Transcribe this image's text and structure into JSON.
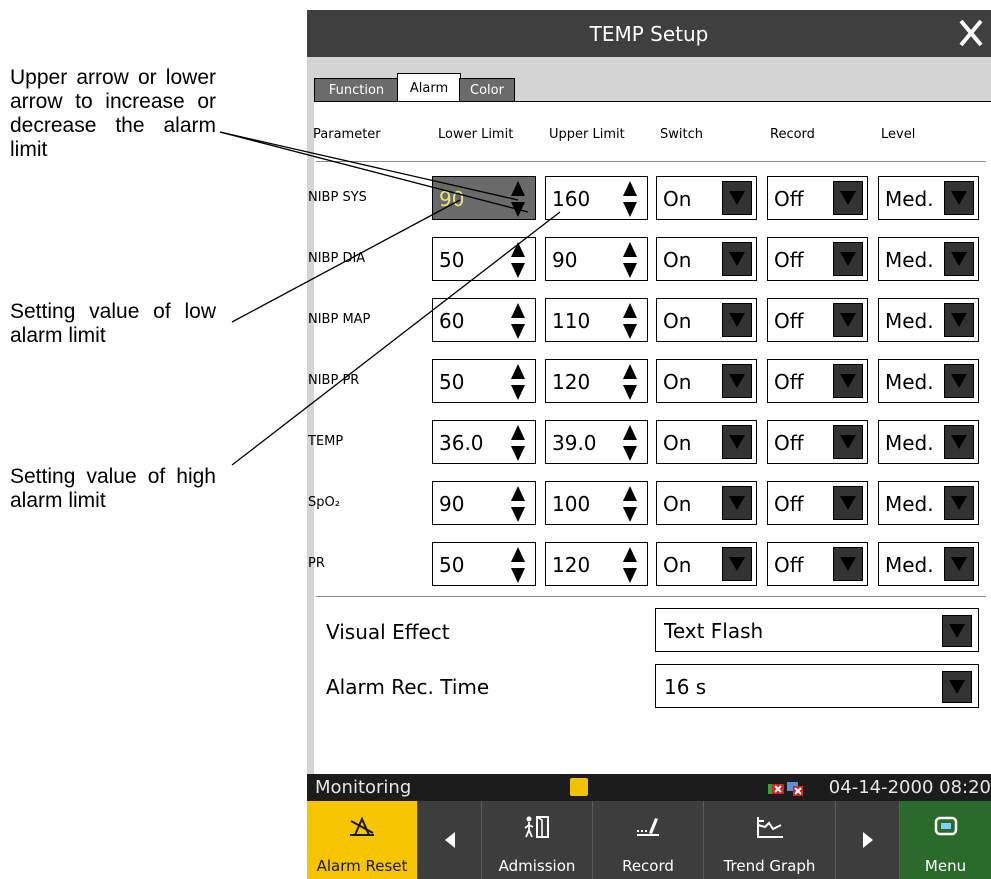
{
  "annotations": {
    "arrows_note": "Upper arrow or lower arrow to increase or decrease the alarm limit",
    "low_note": "Setting value of low alarm limit",
    "high_note": "Setting value of high alarm limit"
  },
  "dialog": {
    "title": "TEMP Setup",
    "close_icon": "close-x-icon",
    "tabs": [
      "Function",
      "Alarm",
      "Color"
    ],
    "active_tab": "Alarm",
    "columns": {
      "parameter": "Parameter",
      "lower": "Lower Limit",
      "upper": "Upper Limit",
      "switch": "Switch",
      "record": "Record",
      "level": "Level"
    },
    "rows": [
      {
        "name": "NIBP SYS",
        "lower": "90",
        "upper": "160",
        "switch": "On",
        "record": "Off",
        "level": "Med."
      },
      {
        "name": "NIBP DIA",
        "lower": "50",
        "upper": "90",
        "switch": "On",
        "record": "Off",
        "level": "Med."
      },
      {
        "name": "NIBP MAP",
        "lower": "60",
        "upper": "110",
        "switch": "On",
        "record": "Off",
        "level": "Med."
      },
      {
        "name": "NIBP PR",
        "lower": "50",
        "upper": "120",
        "switch": "On",
        "record": "Off",
        "level": "Med."
      },
      {
        "name": "TEMP",
        "lower": "36.0",
        "upper": "39.0",
        "switch": "On",
        "record": "Off",
        "level": "Med."
      },
      {
        "name": "SpO₂",
        "lower": "90",
        "upper": "100",
        "switch": "On",
        "record": "Off",
        "level": "Med."
      },
      {
        "name": "PR",
        "lower": "50",
        "upper": "120",
        "switch": "On",
        "record": "Off",
        "level": "Med."
      }
    ],
    "visual_effect": {
      "label": "Visual Effect",
      "value": "Text Flash"
    },
    "alarm_rec_time": {
      "label": "Alarm Rec. Time",
      "value": "16 s"
    }
  },
  "status_bar": {
    "mode": "Monitoring",
    "datetime": "04-14-2000 08:20"
  },
  "toolbar": {
    "alarm_reset": "Alarm Reset",
    "admission": "Admission",
    "record": "Record",
    "trend_graph": "Trend Graph",
    "menu": "Menu"
  },
  "colors": {
    "title_bar": "#3f3f3f",
    "alarm_reset_bg": "#f6c500",
    "menu_bg": "#2a6a2a",
    "selected_value": "#e7e47a"
  }
}
